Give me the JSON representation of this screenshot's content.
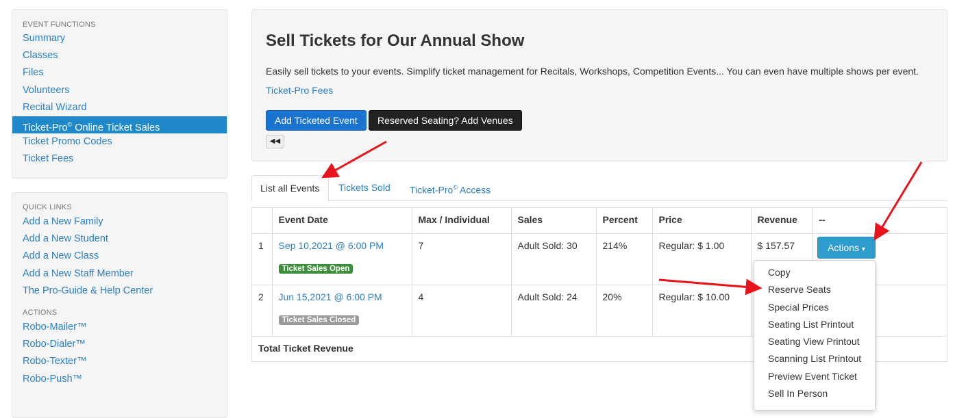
{
  "sidebar": {
    "event_functions": {
      "heading": "EVENT FUNCTIONS",
      "items": [
        {
          "label": "Summary"
        },
        {
          "label": "Classes"
        },
        {
          "label": "Files"
        },
        {
          "label": "Volunteers"
        },
        {
          "label": "Recital Wizard"
        },
        {
          "label": "Ticket-Pro",
          "sup": "©",
          "suffix": " Online Ticket Sales",
          "active": true
        },
        {
          "label": "Ticket Promo Codes"
        },
        {
          "label": "Ticket Fees"
        }
      ]
    },
    "quick_links": {
      "heading": "QUICK LINKS",
      "items": [
        {
          "label": "Add a New Family"
        },
        {
          "label": "Add a New Student"
        },
        {
          "label": "Add a New Class"
        },
        {
          "label": "Add a New Staff Member"
        },
        {
          "label": "The Pro-Guide & Help Center"
        }
      ]
    },
    "actions": {
      "heading": "ACTIONS",
      "items": [
        {
          "label": "Robo-Mailer™"
        },
        {
          "label": "Robo-Dialer™"
        },
        {
          "label": "Robo-Texter™"
        },
        {
          "label": "Robo-Push™"
        }
      ]
    }
  },
  "header": {
    "title": "Sell Tickets for Our Annual Show",
    "description": "Easily sell tickets to your events. Simplify ticket management for Recitals, Workshops, Competition Events... You can even have multiple shows per event.",
    "fees_link": "Ticket-Pro Fees",
    "add_button": "Add Ticketed Event",
    "venues_button": "Reserved Seating? Add Venues",
    "back_icon": "rewind-icon",
    "back_glyph": "◀◀"
  },
  "tabs": [
    {
      "label": "List all Events",
      "active": true
    },
    {
      "label": "Tickets Sold"
    },
    {
      "label": "Ticket-Pro",
      "sup": "©",
      "suffix": " Access"
    }
  ],
  "table": {
    "columns": [
      "",
      "Event Date",
      "Max / Individual",
      "Sales",
      "Percent",
      "Price",
      "Revenue",
      "--"
    ],
    "rows": [
      {
        "num": "1",
        "date": "Sep 10,2021 @ 6:00 PM",
        "status": "Ticket Sales Open",
        "max": "7",
        "sales": "Adult Sold: 30",
        "percent": "214%",
        "price": "Regular: $ 1.00",
        "revenue": "$ 157.57"
      },
      {
        "num": "2",
        "date": "Jun 15,2021 @ 6:00 PM",
        "status": "Ticket Sales Closed",
        "max": "4",
        "sales": "Adult Sold: 24",
        "percent": "20%",
        "price": "Regular: $ 10.00",
        "revenue": ""
      }
    ],
    "total_label": "Total Ticket Revenue"
  },
  "actions_button": {
    "label": "Actions",
    "caret": "▾"
  },
  "dropdown": {
    "items": [
      "Copy",
      "Reserve Seats",
      "Special Prices",
      "Seating List Printout",
      "Seating View Printout",
      "Scanning List Printout",
      "Preview Event Ticket",
      "Sell In Person"
    ]
  },
  "colors": {
    "link": "#2a7fc4",
    "active_nav": "#1f88c8",
    "primary_button": "#1a73d0",
    "dark_button": "#222222",
    "actions_button": "#2e9ccc",
    "badge_open": "#3c8d3c",
    "badge_closed": "#9a9a9a",
    "annotation_arrow": "#e8141b"
  }
}
